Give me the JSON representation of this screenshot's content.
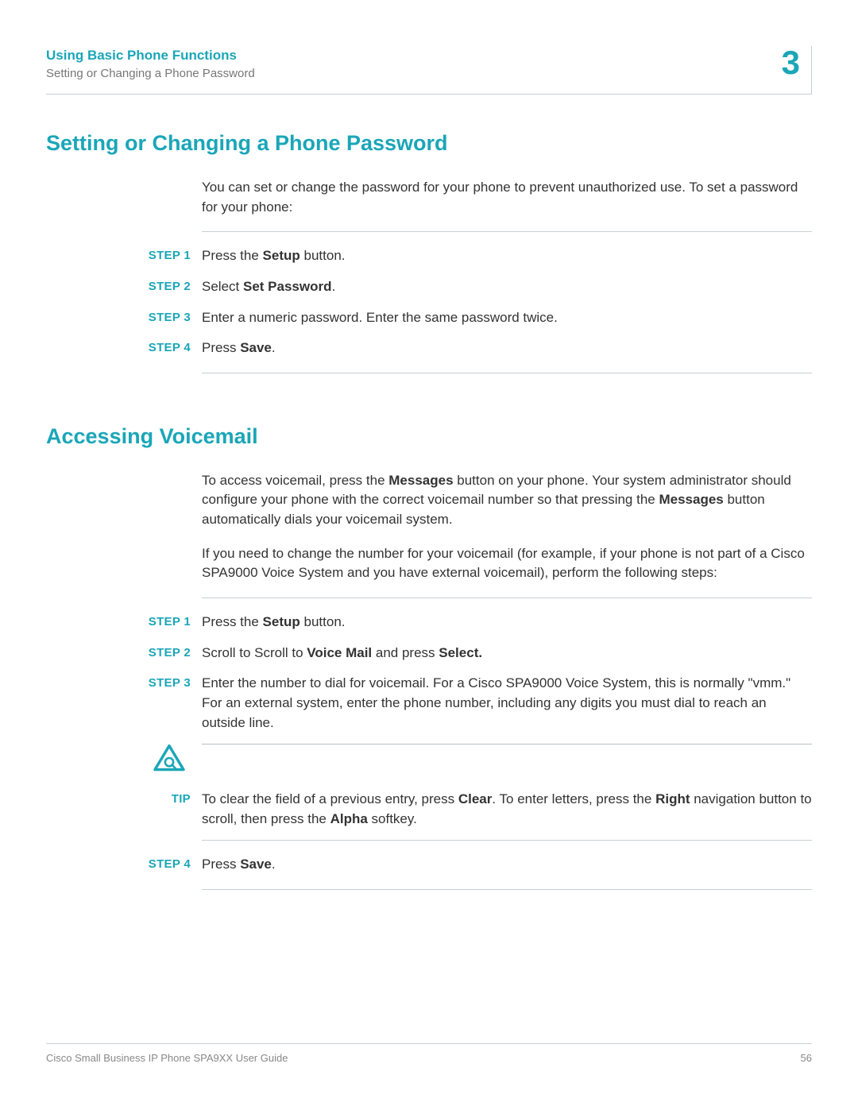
{
  "header": {
    "chapter": "Using Basic Phone Functions",
    "section": "Setting or Changing a Phone Password",
    "chapter_number": "3"
  },
  "sections": [
    {
      "heading": "Setting or Changing a Phone Password",
      "intro_html": "You can set or change the password for your phone to prevent unauthorized use. To set a password for your phone:",
      "steps": [
        {
          "label": "STEP 1",
          "html": "Press the <b>Setup</b> button."
        },
        {
          "label": "STEP 2",
          "html": "Select <b>Set Password</b>."
        },
        {
          "label": "STEP 3",
          "html": "Enter a numeric password. Enter the same password twice."
        },
        {
          "label": "STEP 4",
          "html": "Press <b>Save</b>."
        }
      ]
    },
    {
      "heading": "Accessing Voicemail",
      "intro_html": "To access voicemail, press the <b>Messages</b> button on your phone. Your system administrator should configure your phone with the correct voicemail number so that pressing the <b>Messages</b> button automatically dials your voicemail system.",
      "intro2_html": "If you need to change the number for your voicemail (for example, if your phone is not part of a Cisco SPA9000 Voice System and you have external voicemail), perform the following steps:",
      "steps": [
        {
          "label": "STEP 1",
          "html": "Press the <b>Setup</b> button."
        },
        {
          "label": "STEP 2",
          "html": "Scroll to Scroll to <b>Voice Mail</b> and press <b>Select.</b>"
        },
        {
          "label": "STEP 3",
          "html": "Enter the number to dial for voicemail. For a Cisco SPA9000 Voice System, this is normally \"vmm.\" For an external system, enter the phone number, including any digits you must dial to reach an outside line."
        }
      ],
      "tip": {
        "label": "TIP",
        "html": "To clear the field of a previous entry, press <b>Clear</b>. To enter letters, press the <b>Right</b> navigation button to scroll, then press the <b>Alpha</b> softkey."
      },
      "post_steps": [
        {
          "label": "STEP 4",
          "html": "Press <b>Save</b>."
        }
      ]
    }
  ],
  "footer": {
    "title": "Cisco Small Business IP Phone SPA9XX User Guide",
    "page": "56"
  }
}
